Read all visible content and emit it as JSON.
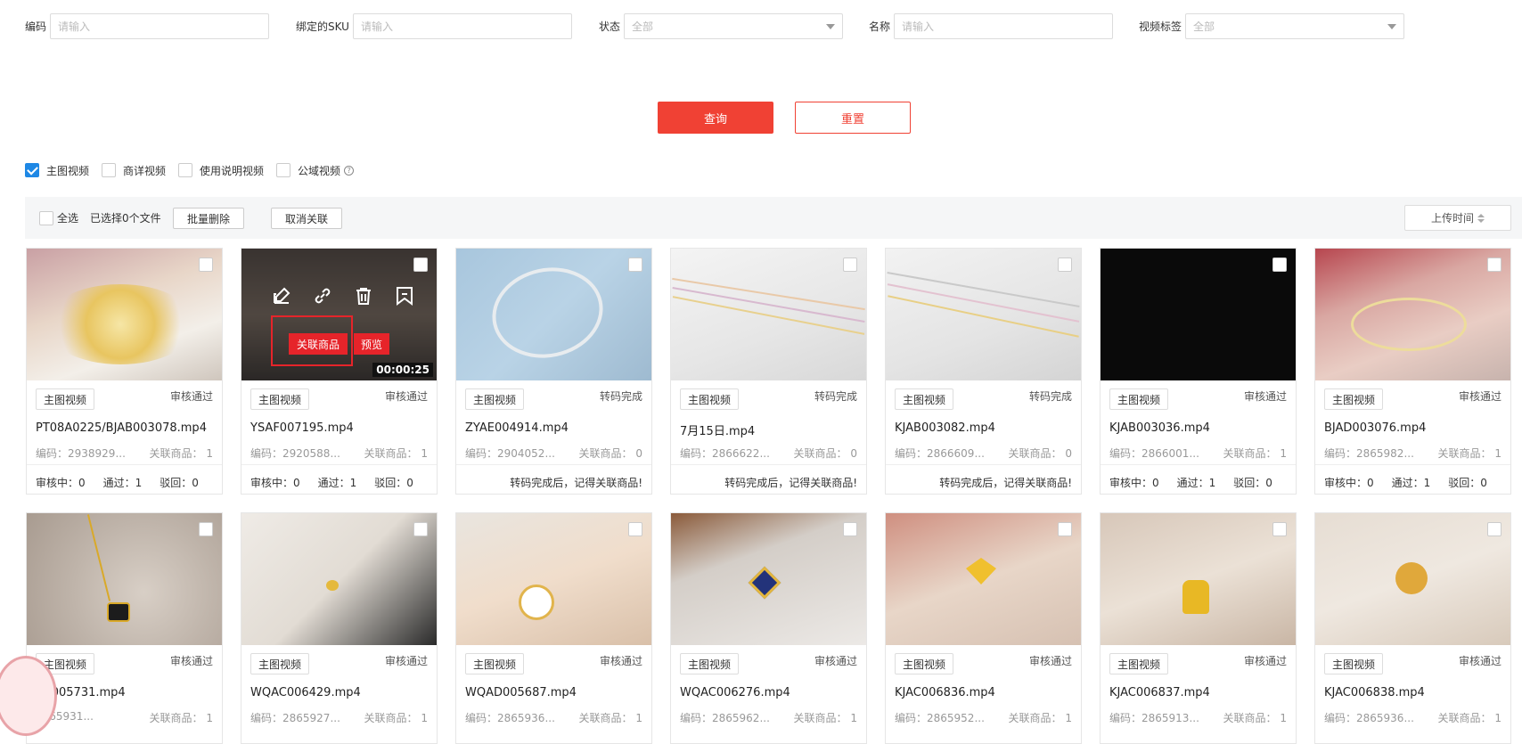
{
  "filters": {
    "code_label": "编码",
    "code_placeholder": "请输入",
    "sku_label": "绑定的SKU",
    "sku_placeholder": "请输入",
    "status_label": "状态",
    "status_value": "全部",
    "name_label": "名称",
    "name_placeholder": "请输入",
    "video_tag_label": "视频标签",
    "video_tag_value": "全部"
  },
  "buttons": {
    "query": "查询",
    "reset": "重置"
  },
  "video_types": [
    {
      "label": "主图视频",
      "checked": true
    },
    {
      "label": "商详视频",
      "checked": false
    },
    {
      "label": "使用说明视频",
      "checked": false
    },
    {
      "label": "公域视频",
      "checked": false
    }
  ],
  "toolbar": {
    "select_all": "全选",
    "selected_count": "已选择0个文件",
    "batch_delete": "批量删除",
    "cancel_link": "取消关联",
    "sort_label": "上传时间"
  },
  "hover_overlay": {
    "link_goods": "关联商品",
    "preview": "预览",
    "duration": "00:00:25"
  },
  "cards": [
    {
      "tag": "主图视频",
      "status": "审核通过",
      "file": "PT08A0225/BJAB003078.mp4",
      "code": "编码：2938929...",
      "link": "关联商品：  1",
      "pending": "审核中：0",
      "passed": "通过：1",
      "rejected": "驳回：0",
      "remind": ""
    },
    {
      "tag": "主图视频",
      "status": "审核通过",
      "file": "YSAF007195.mp4",
      "code": "编码：2920588...",
      "link": "关联商品：  1",
      "pending": "审核中：0",
      "passed": "通过：1",
      "rejected": "驳回：0",
      "remind": ""
    },
    {
      "tag": "主图视频",
      "status": "转码完成",
      "file": "ZYAE004914.mp4",
      "code": "编码：2904052...",
      "link": "关联商品：  0",
      "pending": "",
      "passed": "",
      "rejected": "",
      "remind": "转码完成后，记得关联商品!"
    },
    {
      "tag": "主图视频",
      "status": "转码完成",
      "file": "7月15日.mp4",
      "code": "编码：2866622...",
      "link": "关联商品：  0",
      "pending": "",
      "passed": "",
      "rejected": "",
      "remind": "转码完成后，记得关联商品!"
    },
    {
      "tag": "主图视频",
      "status": "转码完成",
      "file": "KJAB003082.mp4",
      "code": "编码：2866609...",
      "link": "关联商品：  0",
      "pending": "",
      "passed": "",
      "rejected": "",
      "remind": "转码完成后，记得关联商品!"
    },
    {
      "tag": "主图视频",
      "status": "审核通过",
      "file": "KJAB003036.mp4",
      "code": "编码：2866001...",
      "link": "关联商品：  1",
      "pending": "审核中：0",
      "passed": "通过：1",
      "rejected": "驳回：0",
      "remind": ""
    },
    {
      "tag": "主图视频",
      "status": "审核通过",
      "file": "BJAD003076.mp4",
      "code": "编码：2865982...",
      "link": "关联商品：  1",
      "pending": "审核中：0",
      "passed": "通过：1",
      "rejected": "驳回：0",
      "remind": ""
    },
    {
      "tag": "主图视频",
      "status": "审核通过",
      "file": "AC005731.mp4",
      "code": "2865931...",
      "link": "关联商品：  1",
      "pending": "",
      "passed": "",
      "rejected": "",
      "remind": ""
    },
    {
      "tag": "主图视频",
      "status": "审核通过",
      "file": "WQAC006429.mp4",
      "code": "编码：2865927...",
      "link": "关联商品：  1",
      "pending": "",
      "passed": "",
      "rejected": "",
      "remind": ""
    },
    {
      "tag": "主图视频",
      "status": "审核通过",
      "file": "WQAD005687.mp4",
      "code": "编码：2865936...",
      "link": "关联商品：  1",
      "pending": "",
      "passed": "",
      "rejected": "",
      "remind": ""
    },
    {
      "tag": "主图视频",
      "status": "审核通过",
      "file": "WQAC006276.mp4",
      "code": "编码：2865962...",
      "link": "关联商品：  1",
      "pending": "",
      "passed": "",
      "rejected": "",
      "remind": ""
    },
    {
      "tag": "主图视频",
      "status": "审核通过",
      "file": "KJAC006836.mp4",
      "code": "编码：2865952...",
      "link": "关联商品：  1",
      "pending": "",
      "passed": "",
      "rejected": "",
      "remind": ""
    },
    {
      "tag": "主图视频",
      "status": "审核通过",
      "file": "KJAC006837.mp4",
      "code": "编码：2865913...",
      "link": "关联商品：  1",
      "pending": "",
      "passed": "",
      "rejected": "",
      "remind": ""
    },
    {
      "tag": "主图视频",
      "status": "审核通过",
      "file": "KJAC006838.mp4",
      "code": "编码：2865936...",
      "link": "关联商品：  1",
      "pending": "",
      "passed": "",
      "rejected": "",
      "remind": ""
    }
  ],
  "colors": {
    "accent_red": "#f04134",
    "accent_blue": "#1e88e5"
  }
}
